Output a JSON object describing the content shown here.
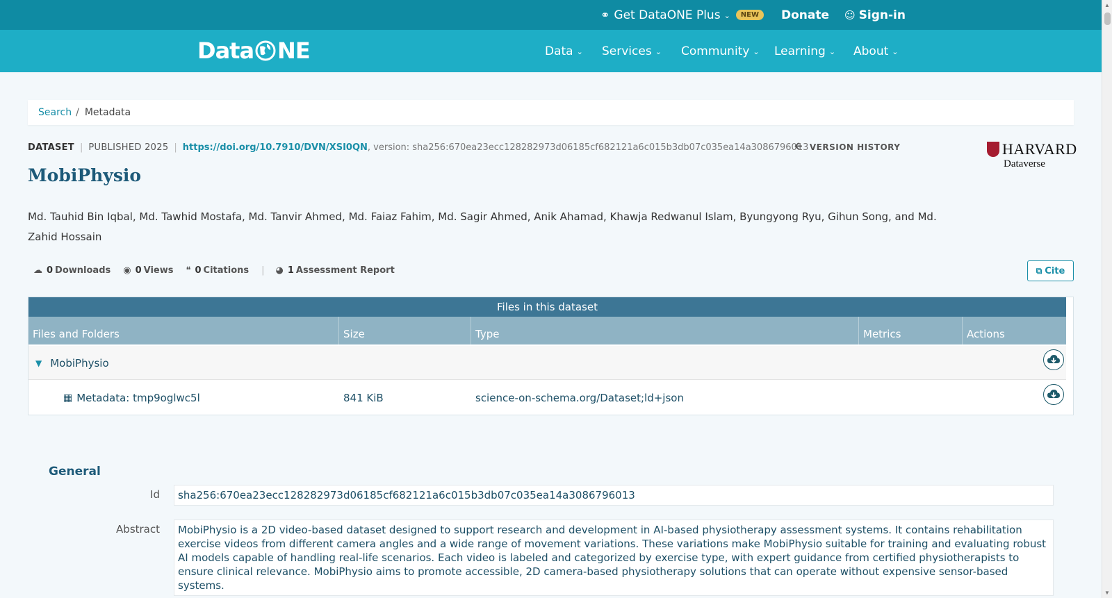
{
  "topbar": {
    "plus_label": "Get DataONE Plus",
    "new_badge": "NEW",
    "donate_label": "Donate",
    "signin_label": "Sign-in"
  },
  "nav": {
    "logo_left": "Data",
    "logo_right": "NE",
    "items": [
      {
        "label": "Data"
      },
      {
        "label": "Services"
      },
      {
        "label": "Community"
      },
      {
        "label": "Learning"
      },
      {
        "label": "About"
      }
    ]
  },
  "breadcrumb": {
    "search_label": "Search",
    "separator": "/",
    "current": "Metadata"
  },
  "dataset": {
    "type": "DATASET",
    "published": "PUBLISHED 2025",
    "doi": "https://doi.org/10.7910/DVN/XSI0QN",
    "version_text": ", version: sha256:670ea23ecc128282973d06185cf682121a6c015b3db07c035ea14a3086796013",
    "version_history_label": "VERSION HISTORY",
    "repository": {
      "line1": "HARVARD",
      "line2": "Dataverse"
    },
    "title": "MobiPhysio",
    "authors": "Md. Tauhid Bin Iqbal, Md. Tawhid Mostafa, Md. Tanvir Ahmed, Md. Faiaz Fahim, Md. Sagir Ahmed, Anik Ahamad, Khawja Redwanul Islam, Byungyong Ryu, Gihun Song, and Md. Zahid Hossain"
  },
  "metrics": {
    "downloads_count": "0",
    "downloads_label": "Downloads",
    "views_count": "0",
    "views_label": "Views",
    "citations_count": "0",
    "citations_label": "Citations",
    "assessment_count": "1",
    "assessment_label": "Assessment Report"
  },
  "cite_label": "Cite",
  "files_table": {
    "caption": "Files in this dataset",
    "headers": [
      "Files and Folders",
      "Size",
      "Type",
      "Metrics",
      "Actions"
    ],
    "folder": {
      "name": "MobiPhysio"
    },
    "file": {
      "name": "Metadata: tmp9oglwc5l",
      "size": "841 KiB",
      "type": "science-on-schema.org/Dataset;ld+json"
    }
  },
  "general": {
    "heading": "General",
    "id_label": "Id",
    "id_value": "sha256:670ea23ecc128282973d06185cf682121a6c015b3db07c035ea14a3086796013",
    "abstract_label": "Abstract",
    "abstract_value": "MobiPhysio is a 2D video-based dataset designed to support research and development in AI-based physiotherapy assessment systems. It contains rehabilitation exercise videos from different camera angles and a wide range of movement variations. These variations make MobiPhysio suitable for training and evaluating robust AI models capable of handling real-life scenarios. Each video is labeled and categorized by exercise type, with expert guidance from certified physiotherapists to ensure clinical relevance. MobiPhysio aims to promote accessible, 2D camera-based physiotherapy solutions that can operate without expensive sensor-based systems."
  },
  "colors": {
    "topbar": "#0f8ba3",
    "navbar": "#1eaec6",
    "accent": "#1a8fa8",
    "title": "#1d5a79",
    "table_caption": "#3d7695",
    "table_header": "#8fb3c4"
  }
}
